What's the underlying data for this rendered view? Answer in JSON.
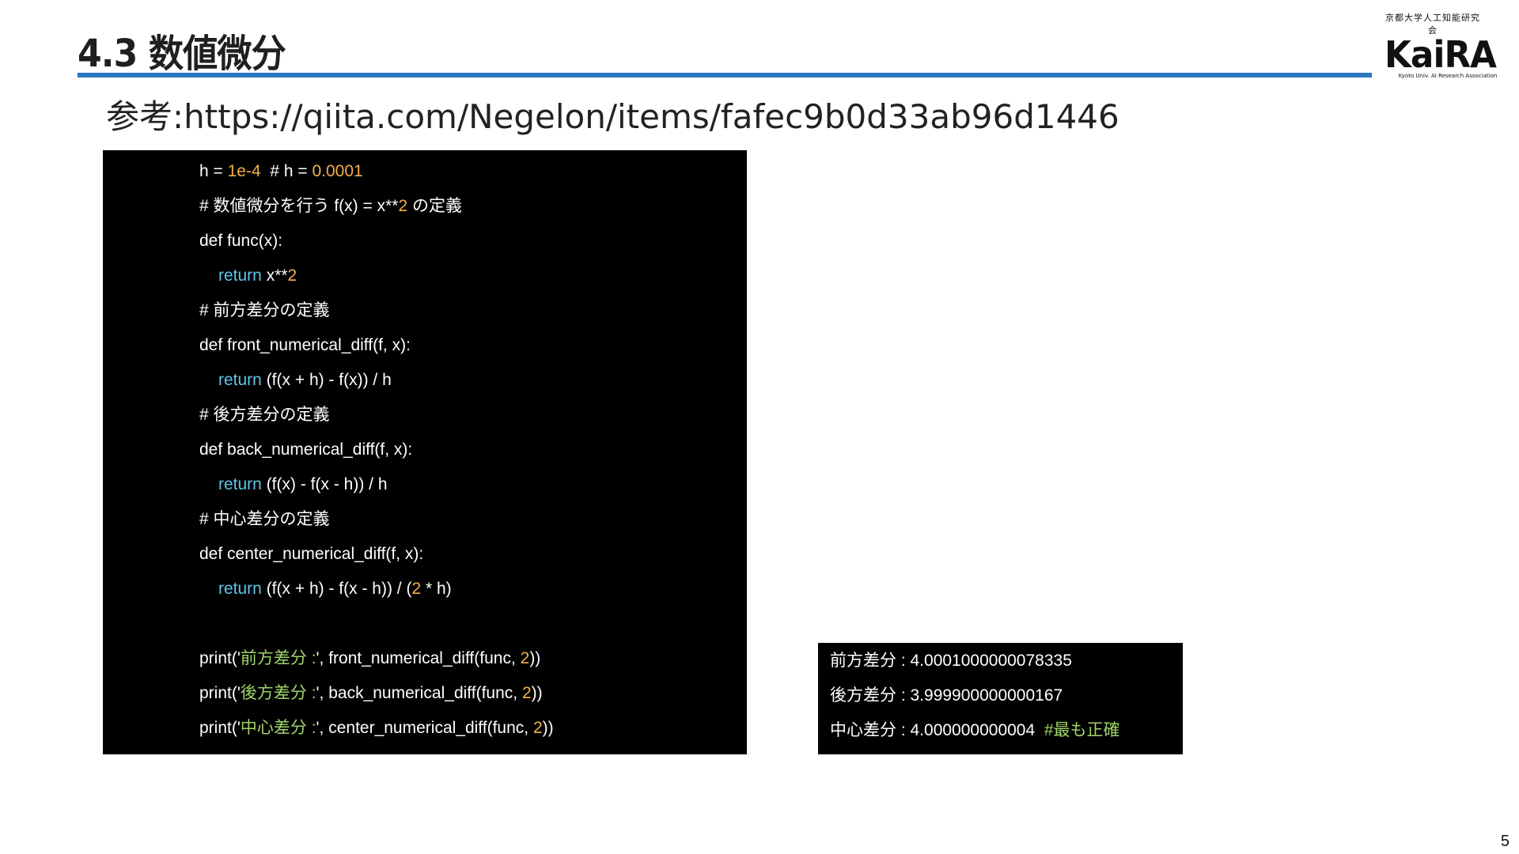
{
  "slide": {
    "title": "4.3 数値微分",
    "reference": "参考:https://qiita.com/Negelon/items/fafec9b0d33ab96d1446",
    "page_number": "5"
  },
  "logo": {
    "subtitle": "京都大学人工知能研究会",
    "name": "KaiRA",
    "tagline": "Kyoto Univ. AI Research Association"
  },
  "colors": {
    "title_rule": "#2a77c0",
    "code_background": "#000000",
    "number": "#f2b04a",
    "keyword": "#5fc4e8",
    "string": "#9fd468"
  },
  "code": {
    "l1": {
      "a": "h = ",
      "b": "1e-4",
      "c": "  # h = ",
      "d": "0.0001"
    },
    "l2": {
      "a": "# 数値微分を行う f(x) = x**",
      "b": "2",
      "c": " の定義"
    },
    "l3": {
      "a": "def func(x):"
    },
    "l4": {
      "kw": "return",
      "a": " x**",
      "b": "2"
    },
    "l5": {
      "a": "# 前方差分の定義"
    },
    "l6": {
      "a": "def front_numerical_diff(f, x):"
    },
    "l7": {
      "kw": "return",
      "a": " (f(x + h) - f(x)) / h"
    },
    "l8": {
      "a": "# 後方差分の定義"
    },
    "l9": {
      "a": "def back_numerical_diff(f, x):"
    },
    "l10": {
      "kw": "return",
      "a": " (f(x) - f(x - h)) / h"
    },
    "l11": {
      "a": "# 中心差分の定義"
    },
    "l12": {
      "a": "def center_numerical_diff(f, x):"
    },
    "l13": {
      "kw": "return",
      "a": " (f(x + h) - f(x - h)) / (",
      "b": "2",
      "c": " * h)"
    },
    "l14": {
      "a": "print('",
      "s": "前方差分 :",
      "b": "', front_numerical_diff(func, ",
      "n": "2",
      "c": "))"
    },
    "l15": {
      "a": "print('",
      "s": "後方差分 :",
      "b": "', back_numerical_diff(func, ",
      "n": "2",
      "c": "))"
    },
    "l16": {
      "a": "print('",
      "s": "中心差分 :",
      "b": "', center_numerical_diff(func, ",
      "n": "2",
      "c": "))"
    }
  },
  "output": {
    "o1": "前方差分 : 4.0001000000078335",
    "o2": "後方差分 : 3.999900000000167",
    "o3": "中心差分 : 4.000000000004",
    "o3_note": "#最も正確"
  }
}
